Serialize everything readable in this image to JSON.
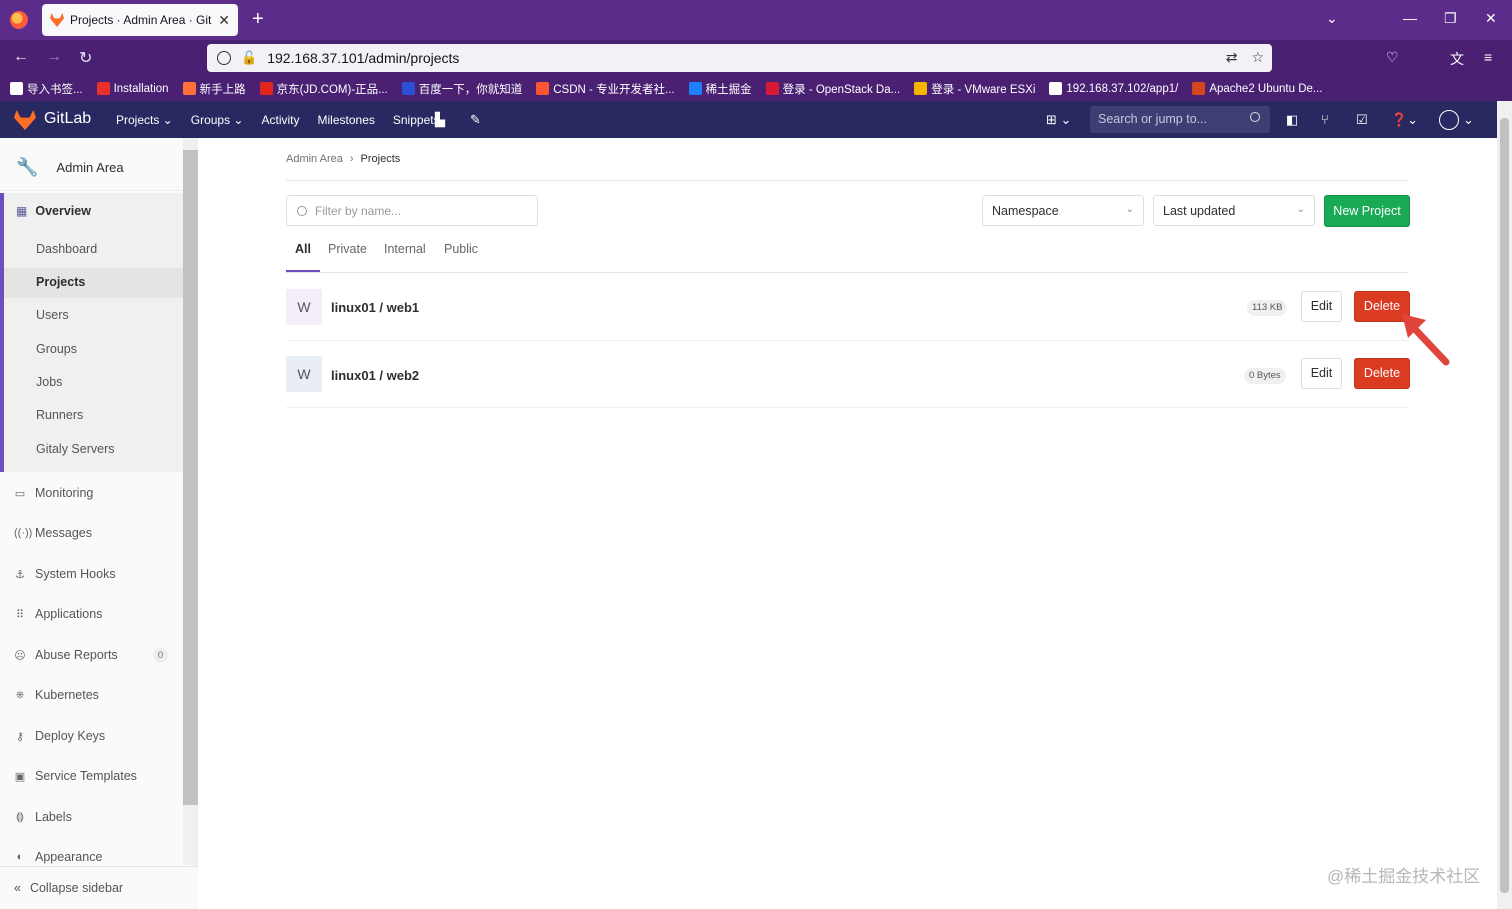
{
  "browser": {
    "tab_title": "Projects · Admin Area · GitLab",
    "tab_close": "✕",
    "new_tab": "+",
    "url": "192.168.37.101/admin/projects",
    "bookmarks": [
      {
        "label": "导入书签...",
        "color": "#ffffff"
      },
      {
        "label": "Installation",
        "color": "#e8312a"
      },
      {
        "label": "新手上路",
        "color": "#ff7139"
      },
      {
        "label": "京东(JD.COM)-正品...",
        "color": "#e1251b"
      },
      {
        "label": "百度一下，你就知道",
        "color": "#2d4fd6"
      },
      {
        "label": "CSDN - 专业开发者社...",
        "color": "#fc5531"
      },
      {
        "label": "稀土掘金",
        "color": "#1e80ff"
      },
      {
        "label": "登录 - OpenStack Da...",
        "color": "#da1a32"
      },
      {
        "label": "登录 - VMware ESXi",
        "color": "#f4b400"
      },
      {
        "label": "192.168.37.102/app1/",
        "color": "#ffffff"
      },
      {
        "label": "Apache2 Ubuntu De...",
        "color": "#d6451b"
      }
    ]
  },
  "gitlab": {
    "brand": "GitLab",
    "menu": [
      "Projects ⌄",
      "Groups ⌄",
      "Activity",
      "Milestones",
      "Snippets"
    ],
    "search_placeholder": "Search or jump to..."
  },
  "sidebar": {
    "title": "Admin Area",
    "overview": "Overview",
    "overview_items": [
      "Dashboard",
      "Projects",
      "Users",
      "Groups",
      "Jobs",
      "Runners",
      "Gitaly Servers"
    ],
    "items": [
      {
        "label": "Monitoring",
        "icon": "monitor-icon",
        "glyph": "▭"
      },
      {
        "label": "Messages",
        "icon": "broadcast-icon",
        "glyph": "((·))"
      },
      {
        "label": "System Hooks",
        "icon": "hook-icon",
        "glyph": "⚓"
      },
      {
        "label": "Applications",
        "icon": "applications-icon",
        "glyph": "⠿"
      },
      {
        "label": "Abuse Reports",
        "icon": "abuse-icon",
        "glyph": "☹"
      },
      {
        "label": "Kubernetes",
        "icon": "kubernetes-icon",
        "glyph": "⎈"
      },
      {
        "label": "Deploy Keys",
        "icon": "key-icon",
        "glyph": "⚷"
      },
      {
        "label": "Service Templates",
        "icon": "template-icon",
        "glyph": "▣"
      },
      {
        "label": "Labels",
        "icon": "label-icon",
        "glyph": "⟬⟭"
      },
      {
        "label": "Appearance",
        "icon": "appearance-icon",
        "glyph": "◐"
      }
    ],
    "abuse_count": "0",
    "collapse": "Collapse sidebar"
  },
  "breadcrumb": {
    "parent": "Admin Area",
    "separator": "›",
    "current": "Projects"
  },
  "filter_placeholder": "Filter by name...",
  "namespace_dropdown": "Namespace",
  "sort_dropdown": "Last updated",
  "new_project": "New Project",
  "tabs": [
    "All",
    "Private",
    "Internal",
    "Public"
  ],
  "projects": [
    {
      "avatar": "W",
      "name": "linux01 / web1",
      "size": "113 KB",
      "edit": "Edit",
      "delete": "Delete"
    },
    {
      "avatar": "W",
      "name": "linux01 / web2",
      "size": "0 Bytes",
      "edit": "Edit",
      "delete": "Delete"
    }
  ],
  "watermark": "@稀土掘金技术社区",
  "colors": {
    "accent": "#6b4fbb",
    "header": "#292961",
    "danger": "#db3b21",
    "success": "#1aaa55"
  }
}
